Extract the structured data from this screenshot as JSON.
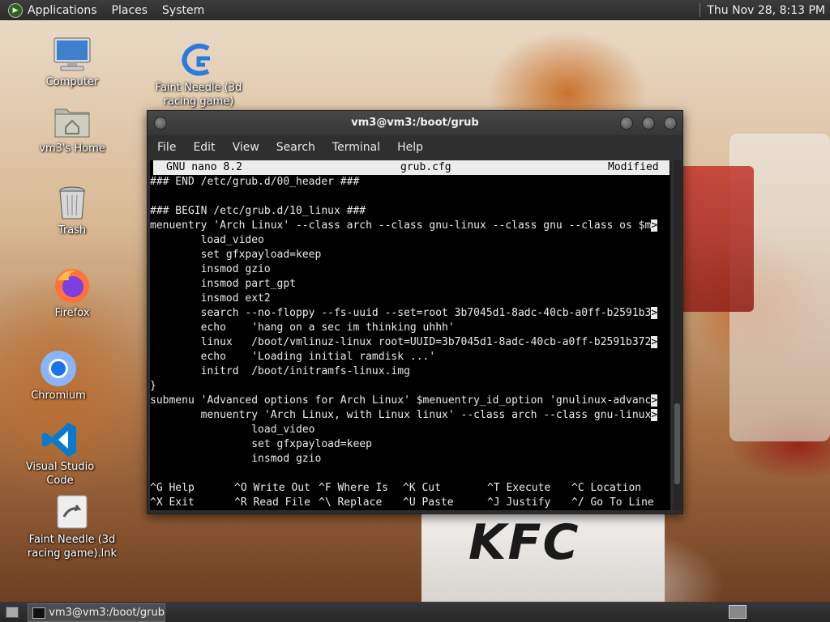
{
  "top_panel": {
    "menus": [
      "Applications",
      "Places",
      "System"
    ],
    "clock": "Thu Nov 28,  8:13 PM"
  },
  "wallpaper": {
    "brand_text": "KFC"
  },
  "desktop_icons": [
    {
      "label": "Computer",
      "icon": "computer-icon"
    },
    {
      "label": "vm3's Home",
      "icon": "home-folder-icon"
    },
    {
      "label": "Trash",
      "icon": "trash-icon"
    },
    {
      "label": "Firefox",
      "icon": "firefox-icon"
    },
    {
      "label": "Chromium",
      "icon": "chromium-icon"
    },
    {
      "label": "Visual Studio Code",
      "icon": "vscode-icon"
    },
    {
      "label": "Faint Needle (3d racing game).lnk",
      "icon": "shortcut-icon"
    },
    {
      "label": "Faint Needle (3d racing game)",
      "icon": "game-icon"
    }
  ],
  "terminal": {
    "title": "vm3@vm3:/boot/grub",
    "menu": [
      "File",
      "Edit",
      "View",
      "Search",
      "Terminal",
      "Help"
    ],
    "nano": {
      "version": "GNU nano 8.2",
      "filename": "grub.cfg",
      "status": "Modified"
    },
    "lines": [
      {
        "text": "### END /etc/grub.d/00_header ###",
        "cont": false
      },
      {
        "text": "",
        "cont": false
      },
      {
        "text": "### BEGIN /etc/grub.d/10_linux ###",
        "cont": false
      },
      {
        "text": "menuentry 'Arch Linux' --class arch --class gnu-linux --class gnu --class os $m",
        "cont": true
      },
      {
        "text": "        load_video",
        "cont": false
      },
      {
        "text": "        set gfxpayload=keep",
        "cont": false
      },
      {
        "text": "        insmod gzio",
        "cont": false
      },
      {
        "text": "        insmod part_gpt",
        "cont": false
      },
      {
        "text": "        insmod ext2",
        "cont": false
      },
      {
        "text": "        search --no-floppy --fs-uuid --set=root 3b7045d1-8adc-40cb-a0ff-b2591b3",
        "cont": true
      },
      {
        "text": "        echo    'hang on a sec im thinking uhhh'",
        "cont": false
      },
      {
        "text": "        linux   /boot/vmlinuz-linux root=UUID=3b7045d1-8adc-40cb-a0ff-b2591b372",
        "cont": true
      },
      {
        "text": "        echo    'Loading initial ramdisk ...'",
        "cont": false
      },
      {
        "text": "        initrd  /boot/initramfs-linux.img",
        "cont": false
      },
      {
        "text": "}",
        "cont": false
      },
      {
        "text": "submenu 'Advanced options for Arch Linux' $menuentry_id_option 'gnulinux-advanc",
        "cont": true
      },
      {
        "text": "        menuentry 'Arch Linux, with Linux linux' --class arch --class gnu-linux",
        "cont": true
      },
      {
        "text": "                load_video",
        "cont": false
      },
      {
        "text": "                set gfxpayload=keep",
        "cont": false
      },
      {
        "text": "                insmod gzio",
        "cont": false
      }
    ],
    "continuation_marker": ">",
    "shortcuts": [
      {
        "key": "^G",
        "label": "Help"
      },
      {
        "key": "^O",
        "label": "Write Out"
      },
      {
        "key": "^F",
        "label": "Where Is"
      },
      {
        "key": "^K",
        "label": "Cut"
      },
      {
        "key": "^T",
        "label": "Execute"
      },
      {
        "key": "^C",
        "label": "Location"
      },
      {
        "key": "^X",
        "label": "Exit"
      },
      {
        "key": "^R",
        "label": "Read File"
      },
      {
        "key": "^\\",
        "label": "Replace"
      },
      {
        "key": "^U",
        "label": "Paste"
      },
      {
        "key": "^J",
        "label": "Justify"
      },
      {
        "key": "^/",
        "label": "Go To Line"
      }
    ]
  },
  "taskbar": {
    "task_title": "vm3@vm3:/boot/grub"
  }
}
